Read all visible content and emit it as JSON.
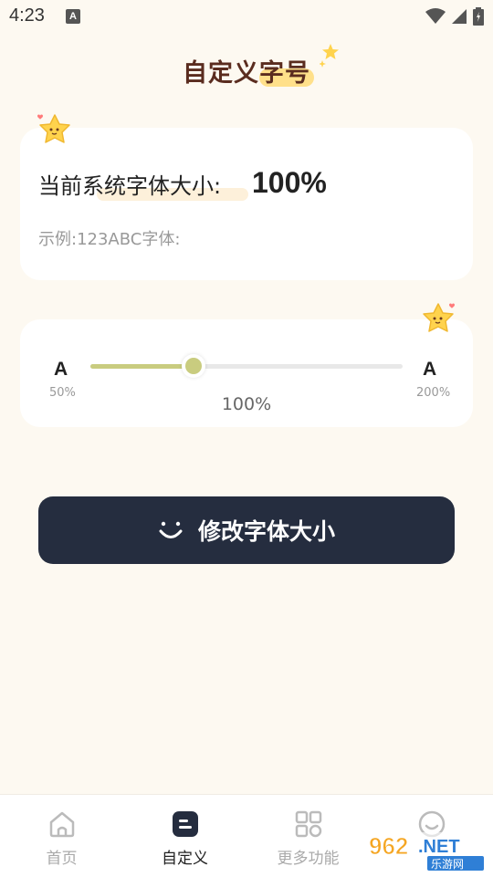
{
  "status_bar": {
    "time": "4:23",
    "indicator": "A",
    "icons": [
      "wifi-icon",
      "signal-icon",
      "battery-icon"
    ]
  },
  "page": {
    "title": "自定义字号"
  },
  "current_card": {
    "label": "当前系统字体大小:",
    "value": "100%",
    "sample": "示例:123ABC字体:"
  },
  "slider_card": {
    "small_glyph": "A",
    "large_glyph": "A",
    "min_label": "50%",
    "max_label": "200%",
    "value_label": "100%",
    "level_fraction": 0.33
  },
  "action_button": {
    "label": "修改字体大小",
    "icon": "smile-icon"
  },
  "bottom_nav": {
    "items": [
      {
        "label": "首页",
        "icon": "home-icon",
        "active": false
      },
      {
        "label": "自定义",
        "icon": "edit-icon",
        "active": true
      },
      {
        "label": "更多功能",
        "icon": "grid-icon",
        "active": false
      },
      {
        "label": "",
        "icon": "smile-icon",
        "active": false
      }
    ]
  },
  "watermark": {
    "text_top": "962.NET",
    "text_bottom": "乐游网"
  },
  "colors": {
    "background": "#fdf9f1",
    "accent": "#c9cc7f",
    "title": "#5a2c1f",
    "button": "#252d3f",
    "star": "#ffd34d"
  }
}
